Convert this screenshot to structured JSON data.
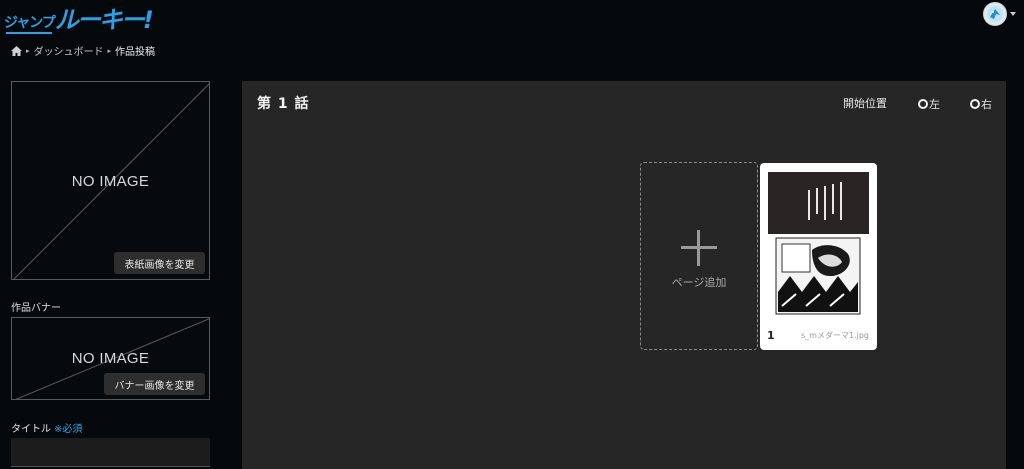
{
  "header": {
    "logo_small": "ジャンプ",
    "logo_big": "ルーキー!"
  },
  "breadcrumb": {
    "dashboard": "ダッシュボード",
    "current": "作品投稿",
    "separator": "▸"
  },
  "cover": {
    "no_image": "NO IMAGE",
    "change_button": "表紙画像を変更"
  },
  "banner": {
    "label": "作品バナー",
    "no_image": "NO IMAGE",
    "change_button": "バナー画像を変更"
  },
  "title_field": {
    "label": "タイトル",
    "required": "※必須",
    "value": ""
  },
  "episode": {
    "title": "第 1 話",
    "start_position_label": "開始位置",
    "options": [
      "左",
      "右"
    ]
  },
  "pages": {
    "add_label": "ページ追加",
    "items": [
      {
        "number": "1",
        "file_name": "s_mメダーマ1.jpg"
      }
    ]
  },
  "colors": {
    "brand": "#2aa0e8",
    "background": "#06090c",
    "panel": "#262626"
  }
}
